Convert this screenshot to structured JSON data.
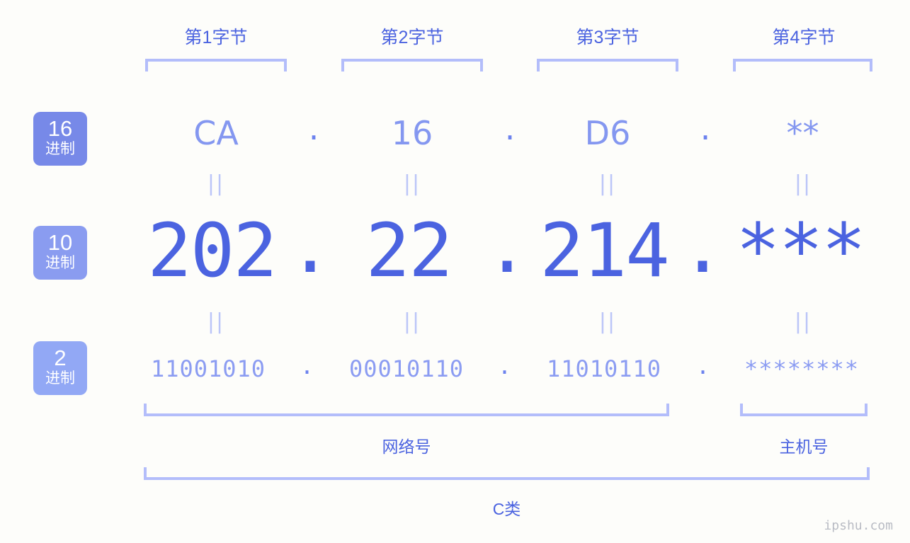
{
  "meta": {
    "watermark": "ipshu.com"
  },
  "byte_titles": [
    {
      "label": "第1字节"
    },
    {
      "label": "第2字节"
    },
    {
      "label": "第3字节"
    },
    {
      "label": "第4字节"
    }
  ],
  "bases": [
    {
      "number": "16",
      "unit": "进制",
      "color": "#7789e8"
    },
    {
      "number": "10",
      "unit": "进制",
      "color": "#8a9cf0"
    },
    {
      "number": "2",
      "unit": "进制",
      "color": "#92a8f5"
    }
  ],
  "rows": {
    "hex": {
      "values": [
        "CA",
        "16",
        "D6",
        "**"
      ],
      "separator": "."
    },
    "decimal": {
      "values": [
        "202",
        "22",
        "214",
        "***"
      ],
      "separator": "."
    },
    "binary": {
      "values": [
        "11001010",
        "00010110",
        "11010110",
        "********"
      ],
      "separator": "."
    }
  },
  "equals_symbol": "||",
  "sections": {
    "network": "网络号",
    "host": "主机号",
    "class": "C类"
  }
}
